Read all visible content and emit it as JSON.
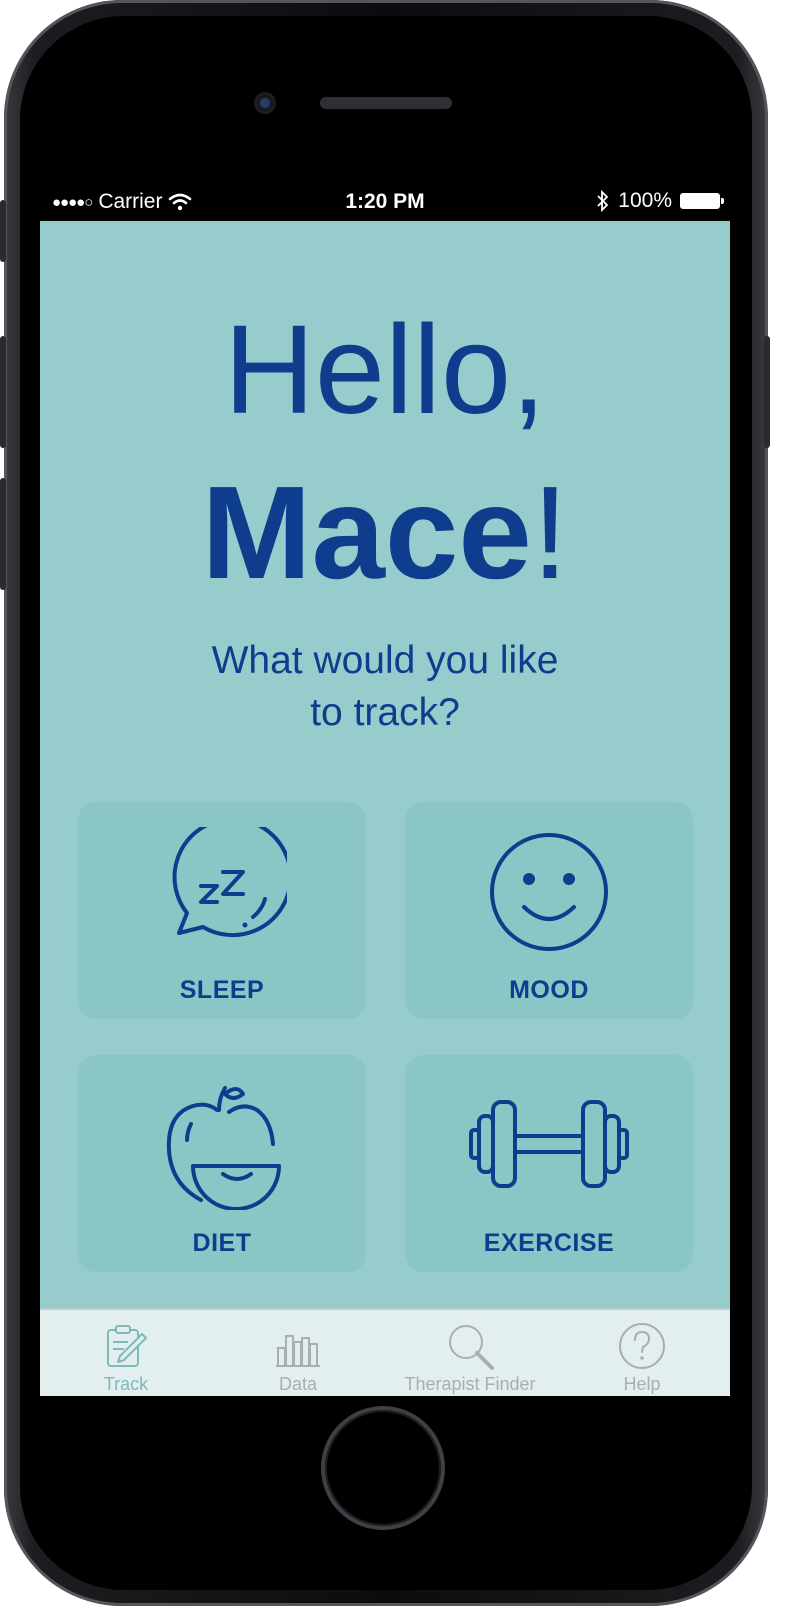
{
  "status_bar": {
    "carrier": "Carrier",
    "time": "1:20 PM",
    "battery": "100%"
  },
  "greeting": {
    "hello": "Hello,",
    "name": "Mace",
    "exclaim": "!",
    "question_line1": "What would you like",
    "question_line2": "to track?"
  },
  "categories": [
    {
      "label": "SLEEP",
      "icon": "sleep-bubble-icon"
    },
    {
      "label": "MOOD",
      "icon": "smiley-face-icon"
    },
    {
      "label": "DIET",
      "icon": "apple-icon"
    },
    {
      "label": "EXERCISE",
      "icon": "dumbbell-icon"
    }
  ],
  "tabbar": {
    "tabs": [
      {
        "label": "Track",
        "icon": "notepad-pencil-icon",
        "active": true
      },
      {
        "label": "Data",
        "icon": "bar-chart-icon",
        "active": false
      },
      {
        "label": "Therapist Finder",
        "icon": "search-icon",
        "active": false
      },
      {
        "label": "Help",
        "icon": "question-circle-icon",
        "active": false
      }
    ]
  },
  "colors": {
    "screen_bg": "#97cccc",
    "card_bg": "#8ac6c6",
    "primary_text": "#0d3d8c",
    "tabbar_bg": "#e3eeee",
    "tab_active": "#7fb9b9",
    "tab_inactive": "#a7b0b0"
  }
}
